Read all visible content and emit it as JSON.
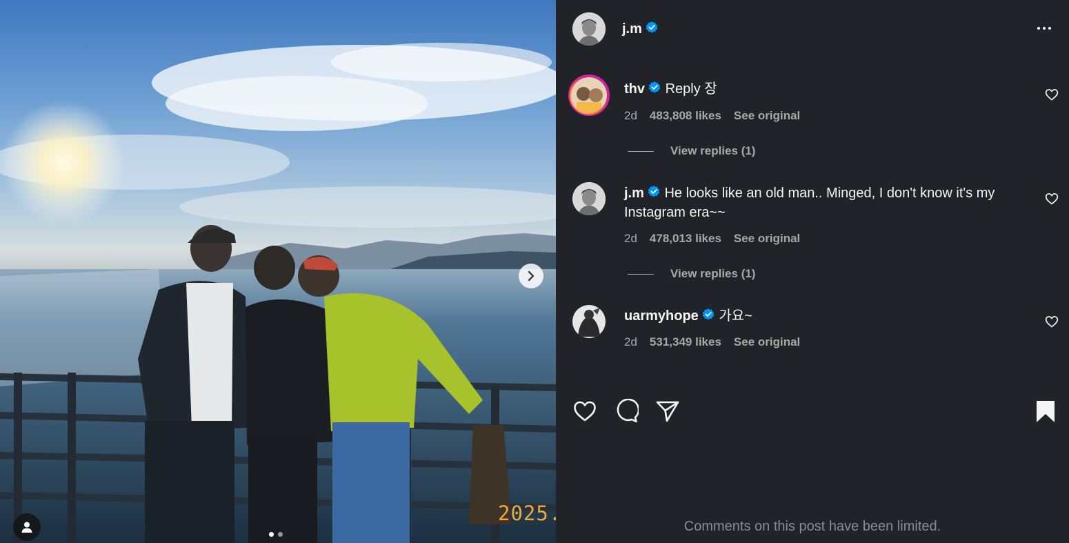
{
  "post": {
    "author": "j.m",
    "date_stamp": "2025.",
    "carousel": {
      "current": 1,
      "total": 2
    }
  },
  "comments": [
    {
      "username": "thv",
      "text": "Reply 장",
      "age": "2d",
      "likes": "483,808 likes",
      "see_original": "See original",
      "view_replies": "View replies (1)"
    },
    {
      "username": "j.m",
      "text": "He looks like an old man.. Minged, I don't know it's my Instagram era~~",
      "age": "2d",
      "likes": "478,013 likes",
      "see_original": "See original",
      "view_replies": "View replies (1)"
    },
    {
      "username": "uarmyhope",
      "text": "가요~",
      "age": "2d",
      "likes": "531,349 likes",
      "see_original": "See original"
    }
  ],
  "footer": {
    "limited_notice": "Comments on this post have been limited."
  },
  "icons": {
    "verified": "verified-badge-icon",
    "more": "more-options-icon",
    "like": "heart-icon",
    "comment": "comment-bubble-icon",
    "share": "paper-plane-icon",
    "save": "bookmark-filled-icon",
    "next": "chevron-right-icon",
    "tag": "user-tag-icon"
  },
  "colors": {
    "panel_bg": "#212328",
    "verified_blue": "#0095f6",
    "muted_text": "#a8a8a8",
    "date_stamp": "#f2a73a"
  }
}
